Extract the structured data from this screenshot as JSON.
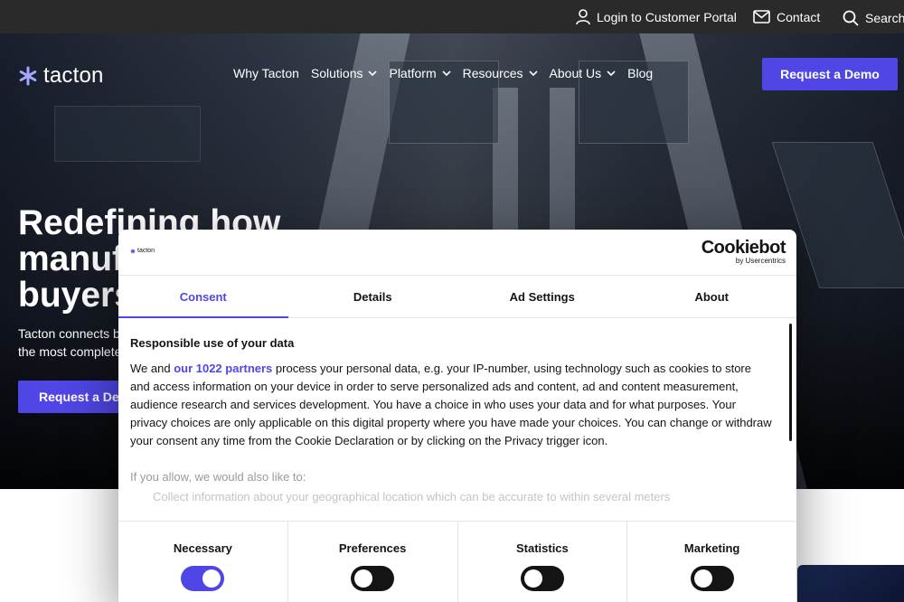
{
  "utility_bar": {
    "login_label": "Login to Customer Portal",
    "contact_label": "Contact",
    "search_label": "Search"
  },
  "header": {
    "logo_text": "tacton",
    "nav": [
      {
        "label": "Why Tacton",
        "has_dropdown": false
      },
      {
        "label": "Solutions",
        "has_dropdown": true
      },
      {
        "label": "Platform",
        "has_dropdown": true
      },
      {
        "label": "Resources",
        "has_dropdown": true
      },
      {
        "label": "About Us",
        "has_dropdown": true
      },
      {
        "label": "Blog",
        "has_dropdown": false
      }
    ],
    "cta_label": "Request a Demo"
  },
  "hero": {
    "title_lines": [
      "Redefining how",
      "manuf",
      "buyers"
    ],
    "subtitle_lines": [
      "Tacton connects bu",
      "the most complete"
    ],
    "cta_label": "Request a Dem"
  },
  "cookie_dialog": {
    "owner_logo_text": "tacton",
    "brand_name": "Cookiebot",
    "brand_sub": "by Usercentrics",
    "tabs": [
      {
        "label": "Consent",
        "active": true
      },
      {
        "label": "Details",
        "active": false
      },
      {
        "label": "Ad Settings",
        "active": false
      },
      {
        "label": "About",
        "active": false
      }
    ],
    "heading": "Responsible use of your data",
    "body_before_link": "We and ",
    "partners_link": "our 1022 partners",
    "body_after_link": " process your personal data, e.g. your IP-number, using technology such as cookies to store and access information on your device in order to serve personalized ads and content, ad and content measurement, audience research and services development. You have a choice in who uses your data and for what purposes. Your privacy choices are only applicable on this digital property where you have made your choices. You can change or withdraw your consent any time from the Cookie Declaration or by clicking on the Privacy trigger icon.",
    "if_allow": "If you allow, we would also like to:",
    "list_item_1": "Collect information about your geographical location which can be accurate to within several meters",
    "toggles": [
      {
        "label": "Necessary",
        "on": true
      },
      {
        "label": "Preferences",
        "on": false
      },
      {
        "label": "Statistics",
        "on": false
      },
      {
        "label": "Marketing",
        "on": false
      }
    ]
  },
  "colors": {
    "accent": "#4f46e5",
    "utility_bar_bg": "#2a2a2a",
    "text_dark": "#141414"
  }
}
